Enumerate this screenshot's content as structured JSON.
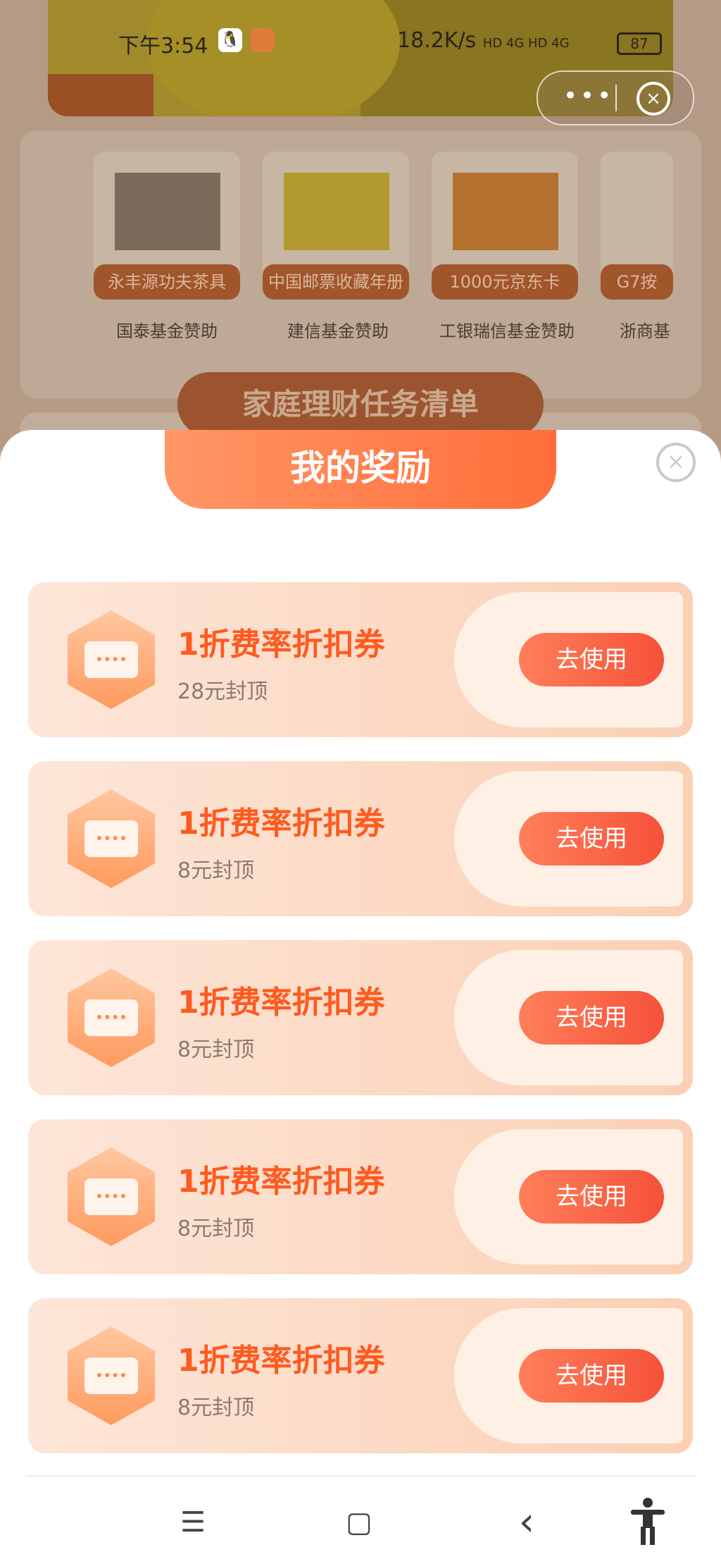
{
  "status_bar": {
    "time": "下午3:54",
    "net_speed": "18.2K/s",
    "signal_text": "HD 4G HD 4G",
    "battery": "87"
  },
  "capsule": {
    "more_icon": "more-dots-icon",
    "close_icon": "close-circle-icon"
  },
  "background": {
    "gifts": [
      {
        "tag": "永丰源功夫茶具",
        "sponsor": "国泰基金赞助"
      },
      {
        "tag": "中国邮票收藏年册",
        "sponsor": "建信基金赞助"
      },
      {
        "tag": "1000元京东卡",
        "sponsor": "工银瑞信基金赞助"
      },
      {
        "tag": "G7按",
        "sponsor": "浙商基"
      }
    ],
    "task_title": "家庭理财任务清单"
  },
  "rewards": {
    "title": "我的奖励",
    "close_icon": "close-circle-icon",
    "coupons": [
      {
        "name": "1折费率折扣券",
        "cap": "28元封顶",
        "button": "去使用"
      },
      {
        "name": "1折费率折扣券",
        "cap": "8元封顶",
        "button": "去使用"
      },
      {
        "name": "1折费率折扣券",
        "cap": "8元封顶",
        "button": "去使用"
      },
      {
        "name": "1折费率折扣券",
        "cap": "8元封顶",
        "button": "去使用"
      },
      {
        "name": "1折费率折扣券",
        "cap": "8元封顶",
        "button": "去使用"
      }
    ]
  },
  "nav": {
    "menu": "☰",
    "home": "▢",
    "back": "‹"
  },
  "colors": {
    "accent": "#ff6e3a",
    "coupon_text": "#ff5a1f",
    "button": "#f5523a"
  }
}
